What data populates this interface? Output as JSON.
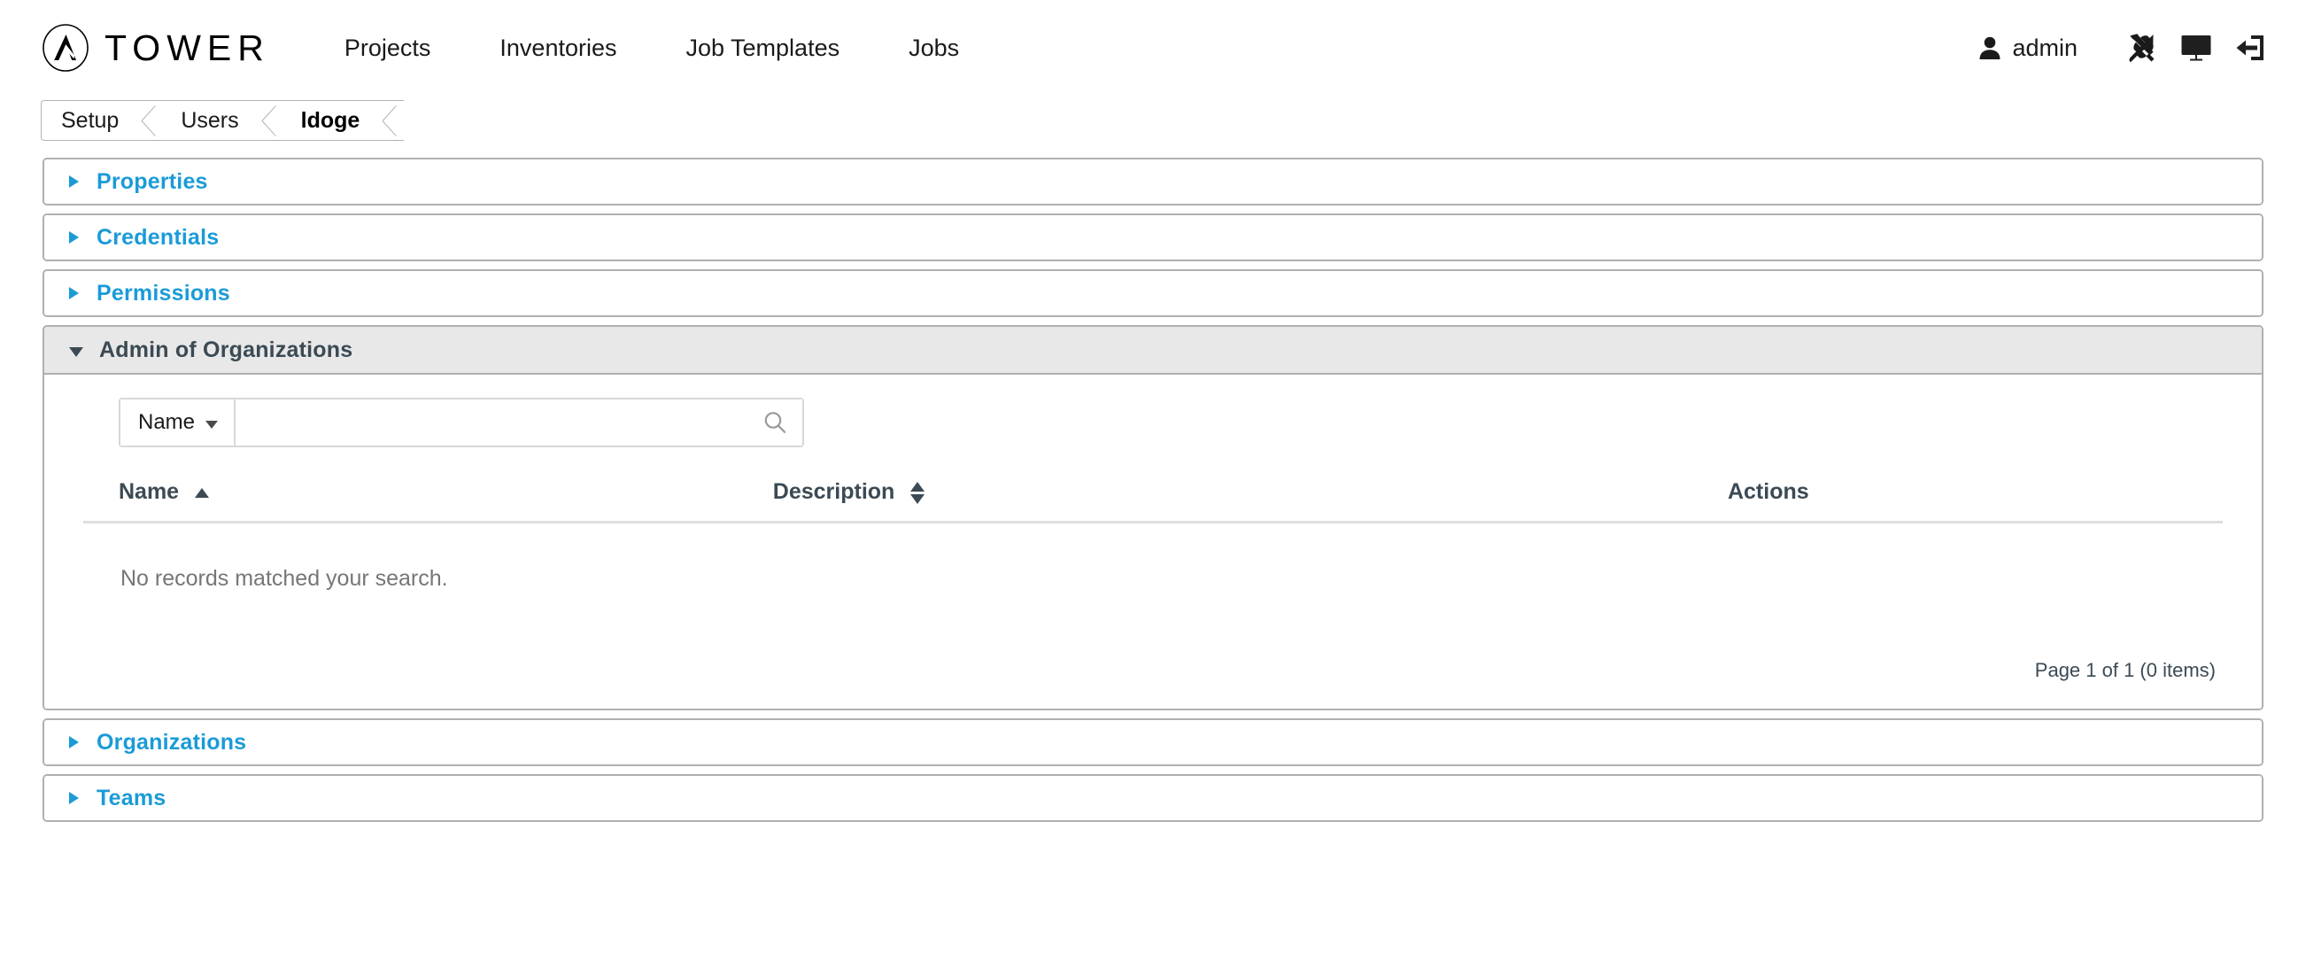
{
  "brand": {
    "name": "TOWER",
    "logo_icon": "ansible-a-logo-icon"
  },
  "nav": {
    "items": [
      {
        "label": "Projects"
      },
      {
        "label": "Inventories"
      },
      {
        "label": "Job Templates"
      },
      {
        "label": "Jobs"
      }
    ]
  },
  "topright": {
    "user_icon": "user-icon",
    "username": "admin",
    "settings_icon": "wrench-screwdriver-icon",
    "view_icon": "monitor-icon",
    "logout_icon": "logout-icon"
  },
  "breadcrumb": {
    "items": [
      {
        "label": "Setup",
        "current": false
      },
      {
        "label": "Users",
        "current": false
      },
      {
        "label": "ldoge",
        "current": true
      }
    ]
  },
  "panels": [
    {
      "title": "Properties",
      "expanded": false,
      "icon": "chevron-right-icon"
    },
    {
      "title": "Credentials",
      "expanded": false,
      "icon": "chevron-right-icon"
    },
    {
      "title": "Permissions",
      "expanded": false,
      "icon": "chevron-right-icon"
    },
    {
      "title": "Admin of Organizations",
      "expanded": true,
      "icon": "chevron-down-icon"
    },
    {
      "title": "Organizations",
      "expanded": false,
      "icon": "chevron-right-icon"
    },
    {
      "title": "Teams",
      "expanded": false,
      "icon": "chevron-down-icon"
    }
  ],
  "admin_of_organizations": {
    "title": "Admin of Organizations",
    "search": {
      "filter_key_label": "Name",
      "filter_key_caret_icon": "caret-down-icon",
      "value": "",
      "placeholder": "",
      "search_icon": "search-icon"
    },
    "table": {
      "columns": [
        {
          "label": "Name",
          "sort": "asc",
          "sort_icon": "sort-asc-icon"
        },
        {
          "label": "Description",
          "sort": "none",
          "sort_icon": "sort-both-icon"
        },
        {
          "label": "Actions",
          "sort": null,
          "sort_icon": null
        }
      ],
      "rows": [],
      "empty_message": "No records matched your search.",
      "pagination": "Page 1 of 1 (0 items)"
    }
  },
  "colors": {
    "accent_blue": "#1a9bd7",
    "heading_dark": "#3b4a54",
    "panel_border": "#b0b0b0",
    "panel_open_header_bg": "#e8e8e8",
    "muted_text": "#767676",
    "divider": "#dedede"
  }
}
